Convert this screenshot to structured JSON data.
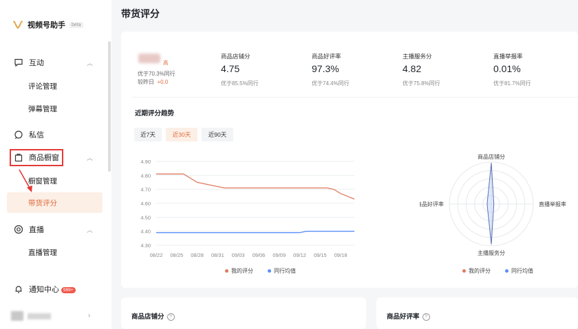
{
  "app": {
    "name": "视频号助手",
    "beta": "beta"
  },
  "sidebar": {
    "groups": [
      {
        "label": "互动",
        "icon": "chat-bubble-icon",
        "expanded": true,
        "children": [
          "评论管理",
          "弹幕管理"
        ]
      },
      {
        "label": "私信",
        "icon": "message-icon"
      },
      {
        "label": "商品橱窗",
        "icon": "shopping-bag-icon",
        "expanded": true,
        "children": [
          "橱窗管理",
          "带货评分"
        ],
        "active_child": "带货评分"
      },
      {
        "label": "直播",
        "icon": "live-icon",
        "expanded": true,
        "children": [
          "直播管理"
        ]
      }
    ],
    "notification": {
      "label": "通知中心",
      "badge": "999+"
    }
  },
  "page": {
    "title": "带货评分"
  },
  "summary": {
    "level": "高",
    "better_than": "优于70.3%同行",
    "vs_yesterday_label": "较昨日",
    "vs_yesterday_value": "+0.0",
    "metrics": [
      {
        "title": "商品店铺分",
        "value": "4.75",
        "sub": "优于85.5%同行"
      },
      {
        "title": "商品好评率",
        "value": "97.3%",
        "sub": "优于74.4%同行"
      },
      {
        "title": "主播服务分",
        "value": "4.82",
        "sub": "优于75.8%同行"
      },
      {
        "title": "直播举报率",
        "value": "0.01%",
        "sub": "优于81.7%同行"
      }
    ]
  },
  "trend": {
    "title": "近期评分趋势",
    "ranges": [
      "近7天",
      "近30天",
      "近90天"
    ],
    "selected_range": "近30天"
  },
  "chart_data": [
    {
      "type": "line",
      "x": [
        "08/22",
        "08/23",
        "08/24",
        "08/25",
        "08/26",
        "08/27",
        "08/28",
        "08/29",
        "08/30",
        "08/31",
        "09/01",
        "09/02",
        "09/03",
        "09/04",
        "09/05",
        "09/06",
        "09/07",
        "09/08",
        "09/09",
        "09/10",
        "09/11",
        "09/12",
        "09/13",
        "09/14",
        "09/15",
        "09/16",
        "09/17",
        "09/18",
        "09/19",
        "09/20"
      ],
      "x_ticks": [
        "08/22",
        "08/25",
        "08/28",
        "08/31",
        "09/03",
        "09/06",
        "09/09",
        "09/12",
        "09/15",
        "09/18"
      ],
      "y_ticks": [
        "4.90",
        "4.80",
        "4.70",
        "4.60",
        "4.50",
        "4.40",
        "4.30"
      ],
      "ylim": [
        4.3,
        4.9
      ],
      "series": [
        {
          "name": "我的评分",
          "color": "#e07a5f",
          "values": [
            4.81,
            4.81,
            4.81,
            4.81,
            4.81,
            4.78,
            4.75,
            4.74,
            4.73,
            4.72,
            4.71,
            4.71,
            4.71,
            4.71,
            4.71,
            4.71,
            4.71,
            4.71,
            4.71,
            4.71,
            4.71,
            4.71,
            4.71,
            4.71,
            4.71,
            4.71,
            4.7,
            4.67,
            4.65,
            4.63
          ]
        },
        {
          "name": "同行均值",
          "color": "#5b8ff9",
          "values": [
            4.39,
            4.39,
            4.39,
            4.39,
            4.39,
            4.39,
            4.39,
            4.39,
            4.39,
            4.39,
            4.39,
            4.39,
            4.39,
            4.39,
            4.39,
            4.39,
            4.39,
            4.39,
            4.39,
            4.39,
            4.39,
            4.39,
            4.4,
            4.4,
            4.4,
            4.4,
            4.4,
            4.4,
            4.4,
            4.4
          ]
        }
      ]
    },
    {
      "type": "radar",
      "axes": [
        "商品店铺分",
        "直播举报率",
        "主播服务分",
        "商品好评率"
      ],
      "series": [
        {
          "name": "我的评分",
          "color": "#e07a5f",
          "values": [
            0.98,
            0.06,
            0.96,
            0.1
          ]
        },
        {
          "name": "同行均值",
          "color": "#5b8ff9",
          "values": [
            0.98,
            0.06,
            0.96,
            0.1
          ]
        }
      ]
    }
  ],
  "bottom_cards": [
    {
      "title": "商品店铺分"
    },
    {
      "title": "商品好评率"
    }
  ]
}
